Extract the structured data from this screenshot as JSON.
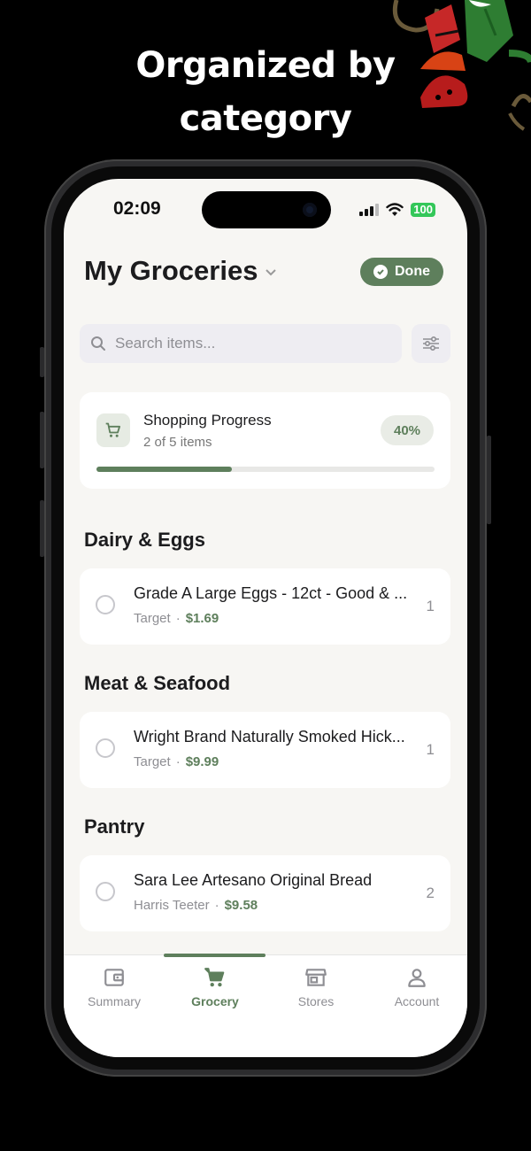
{
  "headline": {
    "line1": "Organized by",
    "line2": "category"
  },
  "status_bar": {
    "time": "02:09",
    "battery": "100"
  },
  "header": {
    "title": "My Groceries",
    "done_label": "Done"
  },
  "search": {
    "placeholder": "Search items..."
  },
  "progress": {
    "title": "Shopping Progress",
    "subtitle": "2 of 5 items",
    "percent_label": "40%",
    "fraction": 0.4
  },
  "sections": [
    {
      "title": "Dairy & Eggs",
      "item": {
        "name": "Grade A Large Eggs - 12ct - Good & ...",
        "store": "Target",
        "price": "$1.69",
        "qty": "1"
      }
    },
    {
      "title": "Meat & Seafood",
      "item": {
        "name": "Wright Brand Naturally Smoked Hick...",
        "store": "Target",
        "price": "$9.99",
        "qty": "1"
      }
    },
    {
      "title": "Pantry",
      "item": {
        "name": "Sara Lee Artesano Original Bread",
        "store": "Harris Teeter",
        "price": "$9.58",
        "qty": "2"
      }
    }
  ],
  "tabs": [
    {
      "label": "Summary",
      "icon": "wallet-icon"
    },
    {
      "label": "Grocery",
      "icon": "cart-icon",
      "active": true
    },
    {
      "label": "Stores",
      "icon": "store-icon"
    },
    {
      "label": "Account",
      "icon": "person-icon"
    }
  ],
  "colors": {
    "accent": "#5e7f5c",
    "background": "#f7f6f3"
  }
}
